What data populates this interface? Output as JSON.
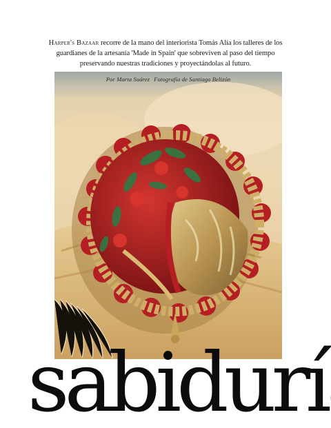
{
  "intro": {
    "brand": "Harper's Bazaar",
    "text": " recorre de la mano del interiorista Tomás Alía los talleres de los guardianes de la artesanía 'Made in Spain' que sobreviven al paso del tiempo preservando nuestras tradiciones y proyectándolas al futuro."
  },
  "credits": {
    "author": "Por Marta Suárez",
    "photographer": "Fotografía de Santiago Belizón"
  },
  "headline": "sabiduría",
  "colors": {
    "gold": "#c9a65a",
    "embroidery_red": "#b51f24",
    "embroidery_green": "#2f7a45",
    "lace_beige": "#e9d3ab"
  }
}
